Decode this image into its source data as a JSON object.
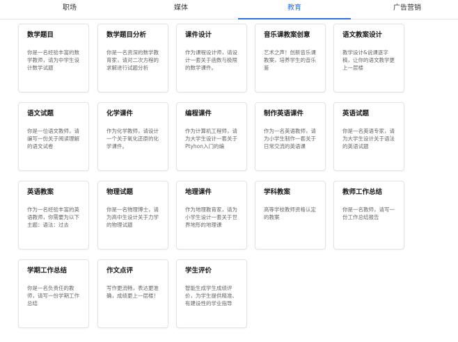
{
  "tabs": [
    {
      "label": "职场"
    },
    {
      "label": "媒体"
    },
    {
      "label": "教育"
    },
    {
      "label": "广告营销"
    }
  ],
  "active_tab": "教育",
  "accent_color": "#2f6fdf",
  "cards": [
    {
      "title": "数学题目",
      "desc": "你是一名经验丰富的数学教师，请为中学生设计数学试题"
    },
    {
      "title": "数学题目分析",
      "desc": "你是一名资深的数学教育家，请对二次方程的求解进行试题分析"
    },
    {
      "title": "课件设计",
      "desc": "作为课程设计师，请设计一套关于函数与极限的数学课件。"
    },
    {
      "title": "音乐课教案创意",
      "desc": "艺术之声！创新音乐课教案，培养学生的音乐鉴"
    },
    {
      "title": "语文教案设计",
      "desc": "教学设计&说课逐字稿，让你的语文教学更上一层楼"
    },
    {
      "title": "语文试题",
      "desc": "你是一位语文教师，请编写一份关于阅读理解的语文试卷"
    },
    {
      "title": "化学课件",
      "desc": "作为化学教师，请设计一个关于氧化还原的化学课件。"
    },
    {
      "title": "编程课件",
      "desc": "作为计算机工程师，请为大学生设计一套关于Ptyhon入门的编"
    },
    {
      "title": "制作英语课件",
      "desc": "作为一名英语教师，请为小学生制作一套关于日常交流的英语课"
    },
    {
      "title": "英语试题",
      "desc": "你是一名英语专家，请为大学生设计关于语法的英语试题"
    },
    {
      "title": "英语教案",
      "desc": "作为一名经验丰富的英语教师，你需要为以下主题：语法：过去"
    },
    {
      "title": "物理试题",
      "desc": "你是一名物理博士，请为高中生设计关于力学的物理试题"
    },
    {
      "title": "地理课件",
      "desc": "作为地理教育家，请为小学生设计一套关于世界地形的地理课"
    },
    {
      "title": "学科教案",
      "desc": "高等学校教师资格认定的教案"
    },
    {
      "title": "教师工作总结",
      "desc": "你是一名教师，请写一份工作总结报告"
    },
    {
      "title": "学期工作总结",
      "desc": "你是一名负责任的教师，请写一份学期工作总结"
    },
    {
      "title": "作文点评",
      "desc": "写作更流畅，表达更准确，成绩更上一层楼！"
    },
    {
      "title": "学生评价",
      "desc": "智能生成学生成绩评价，为学生提供精准、有建设性的学业指导"
    }
  ]
}
